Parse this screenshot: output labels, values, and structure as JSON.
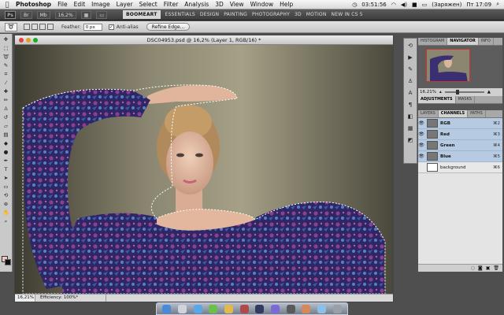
{
  "menubar": {
    "app_name": "Photoshop",
    "items": [
      "File",
      "Edit",
      "Image",
      "Layer",
      "Select",
      "Filter",
      "Analysis",
      "3D",
      "View",
      "Window",
      "Help"
    ],
    "time_left": "03:51:56",
    "battery": "(Заряжен)",
    "clock": "Пт 17:09"
  },
  "appbar": {
    "ps_logo": "Ps",
    "zoom": "16,2%",
    "workspaces": [
      "BOOMEART",
      "ESSENTIALS",
      "DESIGN",
      "PAINTING",
      "PHOTOGRAPHY",
      "3D",
      "MOTION",
      "NEW IN CS 5"
    ]
  },
  "options": {
    "feather_label": "Feather:",
    "feather_value": "0 px",
    "antialias_label": "Anti-alias",
    "refine_label": "Refine Edge..."
  },
  "document": {
    "title": "DSC04953.psd @ 16,2% (Layer 1, RGB/16) *",
    "zoom": "16,21%",
    "status": "Efficiency: 100%*"
  },
  "panels": {
    "nav_tabs": [
      "HISTOGRAM",
      "NAVIGATOR",
      "INFO"
    ],
    "nav_zoom": "16.21%",
    "adj_tabs": [
      "ADJUSTMENTS",
      "MASKS"
    ],
    "layer_tabs": [
      "LAYERS",
      "CHANNELS",
      "PATHS"
    ],
    "channels": [
      {
        "name": "RGB",
        "shortcut": "⌘2"
      },
      {
        "name": "Red",
        "shortcut": "⌘3"
      },
      {
        "name": "Green",
        "shortcut": "⌘4"
      },
      {
        "name": "Blue",
        "shortcut": "⌘5"
      },
      {
        "name": "background",
        "shortcut": "⌘6"
      }
    ]
  },
  "icons": {
    "apple": "apple-icon",
    "wifi": "wifi-icon",
    "volume": "volume-icon",
    "search": "search-icon"
  }
}
